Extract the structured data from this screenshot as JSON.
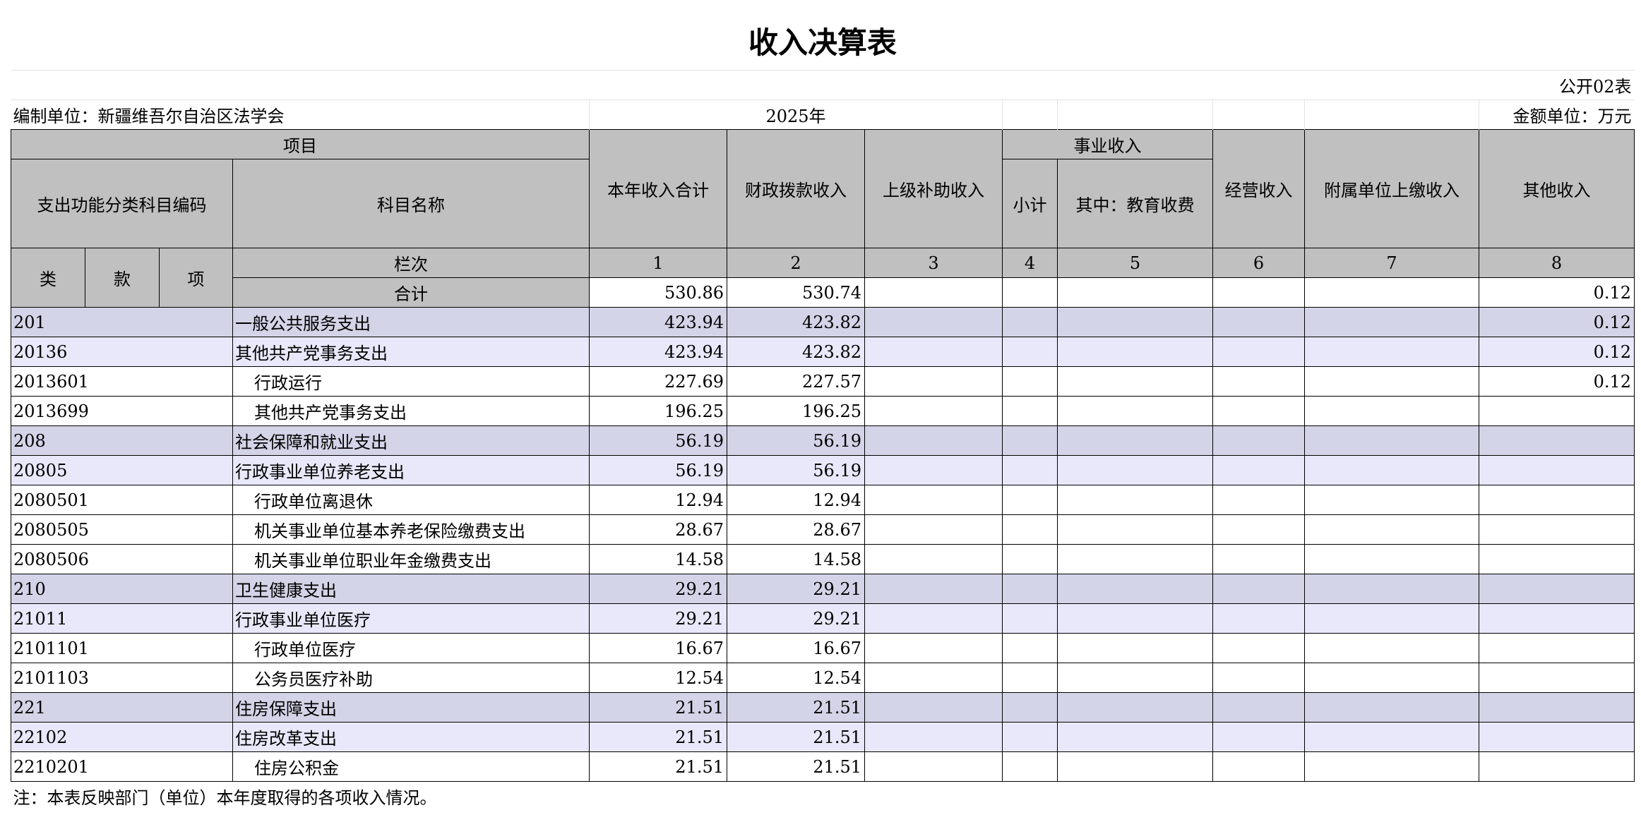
{
  "title": "收入决算表",
  "form_code": "公开02表",
  "unit_label": "编制单位：新疆维吾尔自治区法学会",
  "year": "2025年",
  "amount_unit": "金额单位：万元",
  "headers": {
    "project": "项目",
    "func_code": "支出功能分类科目编码",
    "subject_name": "科目名称",
    "total_income": "本年收入合计",
    "fiscal": "财政拨款收入",
    "superior": "上级补助收入",
    "business_income": "事业收入",
    "subtotal": "小计",
    "edu_fee": "其中：教育收费",
    "operating": "经营收入",
    "affiliated": "附属单位上缴收入",
    "other": "其他收入",
    "lei": "类",
    "kuan": "款",
    "xiang": "项",
    "column_no": "栏次",
    "col_nums": [
      "1",
      "2",
      "3",
      "4",
      "5",
      "6",
      "7",
      "8"
    ],
    "total_label": "合计"
  },
  "totals": {
    "total_income": "530.86",
    "fiscal": "530.74",
    "other": "0.12"
  },
  "rows": [
    {
      "code": "201",
      "name": "一般公共服务支出",
      "level": 1,
      "total": "423.94",
      "fiscal": "423.82",
      "other": "0.12"
    },
    {
      "code": "20136",
      "name": "其他共产党事务支出",
      "level": 2,
      "total": "423.94",
      "fiscal": "423.82",
      "other": "0.12"
    },
    {
      "code": "2013601",
      "name": "行政运行",
      "level": 3,
      "total": "227.69",
      "fiscal": "227.57",
      "other": "0.12"
    },
    {
      "code": "2013699",
      "name": "其他共产党事务支出",
      "level": 3,
      "total": "196.25",
      "fiscal": "196.25",
      "other": ""
    },
    {
      "code": "208",
      "name": "社会保障和就业支出",
      "level": 1,
      "total": "56.19",
      "fiscal": "56.19",
      "other": ""
    },
    {
      "code": "20805",
      "name": "行政事业单位养老支出",
      "level": 2,
      "total": "56.19",
      "fiscal": "56.19",
      "other": ""
    },
    {
      "code": "2080501",
      "name": "行政单位离退休",
      "level": 3,
      "total": "12.94",
      "fiscal": "12.94",
      "other": ""
    },
    {
      "code": "2080505",
      "name": "机关事业单位基本养老保险缴费支出",
      "level": 3,
      "total": "28.67",
      "fiscal": "28.67",
      "other": ""
    },
    {
      "code": "2080506",
      "name": "机关事业单位职业年金缴费支出",
      "level": 3,
      "total": "14.58",
      "fiscal": "14.58",
      "other": ""
    },
    {
      "code": "210",
      "name": "卫生健康支出",
      "level": 1,
      "total": "29.21",
      "fiscal": "29.21",
      "other": ""
    },
    {
      "code": "21011",
      "name": "行政事业单位医疗",
      "level": 2,
      "total": "29.21",
      "fiscal": "29.21",
      "other": ""
    },
    {
      "code": "2101101",
      "name": "行政单位医疗",
      "level": 3,
      "total": "16.67",
      "fiscal": "16.67",
      "other": ""
    },
    {
      "code": "2101103",
      "name": "公务员医疗补助",
      "level": 3,
      "total": "12.54",
      "fiscal": "12.54",
      "other": ""
    },
    {
      "code": "221",
      "name": "住房保障支出",
      "level": 1,
      "total": "21.51",
      "fiscal": "21.51",
      "other": ""
    },
    {
      "code": "22102",
      "name": "住房改革支出",
      "level": 2,
      "total": "21.51",
      "fiscal": "21.51",
      "other": ""
    },
    {
      "code": "2210201",
      "name": "住房公积金",
      "level": 3,
      "total": "21.51",
      "fiscal": "21.51",
      "other": ""
    }
  ],
  "note": "注：本表反映部门（单位）本年度取得的各项收入情况。",
  "colors": {
    "header_bg": "#c0c0c0",
    "level1_bg": "#d4d4e8",
    "level2_bg": "#e8e8fa"
  }
}
